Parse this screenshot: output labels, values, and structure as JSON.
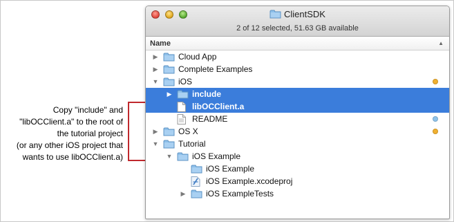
{
  "annotation": {
    "lines": [
      "Copy \"include\" and",
      "\"libOCClient.a\" to the root of",
      "the tutorial project",
      "(or any other iOS project that",
      "wants to use libOCClient.a)"
    ],
    "color": "#c0282d"
  },
  "window": {
    "title": "ClientSDK",
    "status": "2 of 12 selected, 51.63 GB available",
    "column_header": "Name",
    "sort_indicator": "▲"
  },
  "rows": [
    {
      "label": "Cloud App",
      "disclosure": "collapsed",
      "icon": "folder",
      "level": 0,
      "selected": false,
      "tag": null
    },
    {
      "label": "Complete Examples",
      "disclosure": "collapsed",
      "icon": "folder",
      "level": 0,
      "selected": false,
      "tag": null
    },
    {
      "label": "iOS",
      "disclosure": "expanded",
      "icon": "folder",
      "level": 0,
      "selected": false,
      "tag": "#f0b030"
    },
    {
      "label": "include",
      "disclosure": "collapsed",
      "icon": "folder",
      "level": 1,
      "selected": true,
      "tag": null
    },
    {
      "label": "libOCClient.a",
      "disclosure": "none",
      "icon": "file",
      "level": 1,
      "selected": true,
      "tag": null
    },
    {
      "label": "README",
      "disclosure": "none",
      "icon": "document",
      "level": 1,
      "selected": false,
      "tag": "#8fc4ec"
    },
    {
      "label": "OS X",
      "disclosure": "collapsed",
      "icon": "folder",
      "level": 0,
      "selected": false,
      "tag": "#f0b030"
    },
    {
      "label": "Tutorial",
      "disclosure": "expanded",
      "icon": "folder",
      "level": 0,
      "selected": false,
      "tag": null
    },
    {
      "label": "iOS Example",
      "disclosure": "expanded",
      "icon": "folder",
      "level": 1,
      "selected": false,
      "tag": null
    },
    {
      "label": "iOS Example",
      "disclosure": "none",
      "icon": "folder",
      "level": 2,
      "selected": false,
      "tag": null
    },
    {
      "label": "iOS Example.xcodeproj",
      "disclosure": "none",
      "icon": "xcodeproj",
      "level": 2,
      "selected": false,
      "tag": null
    },
    {
      "label": "iOS ExampleTests",
      "disclosure": "collapsed",
      "icon": "folder",
      "level": 2,
      "selected": false,
      "tag": null
    }
  ]
}
